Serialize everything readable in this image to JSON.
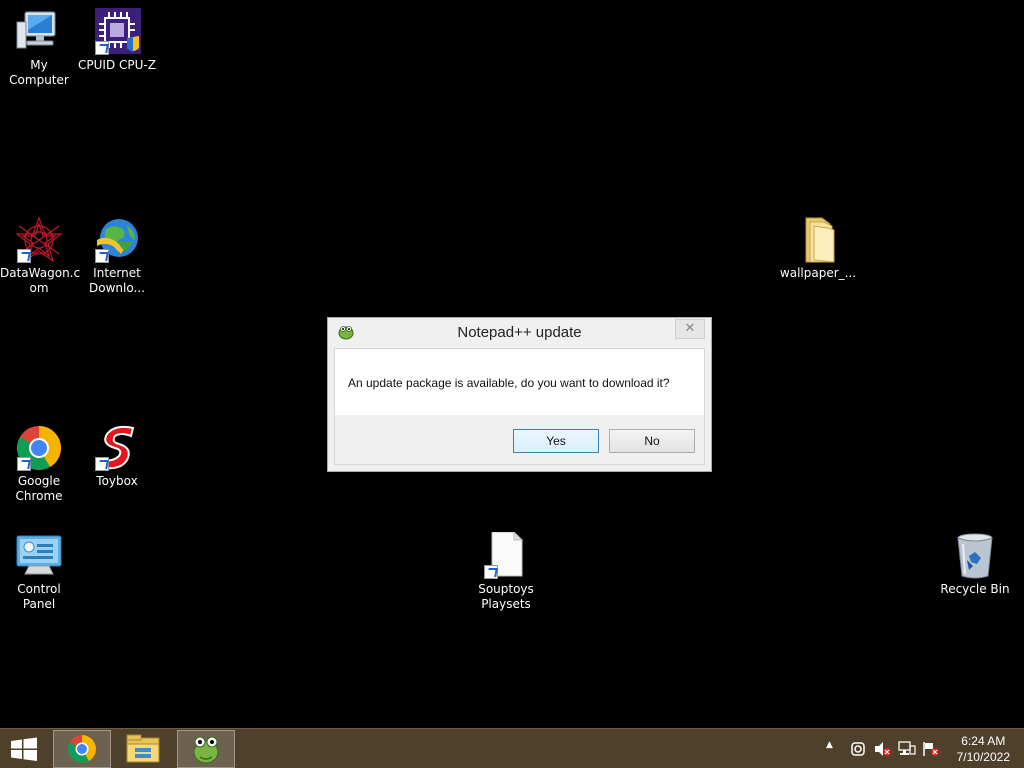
{
  "desktop": {
    "icons": [
      {
        "id": "my-computer",
        "label_lines": [
          "My Computer"
        ],
        "icon": "computer-icon",
        "shortcut": false
      },
      {
        "id": "cpuz",
        "label_lines": [
          "CPUID CPU-Z"
        ],
        "icon": "cpu-chip-icon",
        "shortcut": true
      },
      {
        "id": "datawagon",
        "label_lines": [
          "DataWagon.c",
          "om"
        ],
        "icon": "datawagon-star-icon",
        "shortcut": true
      },
      {
        "id": "idm",
        "label_lines": [
          "Internet",
          "Downlo..."
        ],
        "icon": "globe-download-icon",
        "shortcut": true
      },
      {
        "id": "wallpaper",
        "label_lines": [
          "wallpaper_..."
        ],
        "icon": "folder-icon",
        "shortcut": false
      },
      {
        "id": "chrome",
        "label_lines": [
          "Google",
          "Chrome"
        ],
        "icon": "chrome-icon",
        "shortcut": true
      },
      {
        "id": "toybox",
        "label_lines": [
          "Toybox"
        ],
        "icon": "toybox-s-icon",
        "shortcut": true
      },
      {
        "id": "control-panel",
        "label_lines": [
          "Control Panel"
        ],
        "icon": "control-panel-icon",
        "shortcut": false
      },
      {
        "id": "souptoys",
        "label_lines": [
          "Souptoys",
          "Playsets"
        ],
        "icon": "document-icon",
        "shortcut": true
      },
      {
        "id": "recycle",
        "label_lines": [
          "Recycle Bin"
        ],
        "icon": "recycle-bin-icon",
        "shortcut": false
      }
    ]
  },
  "dialog": {
    "title": "Notepad++ update",
    "message": "An update package is available, do you want to download it?",
    "yes_label": "Yes",
    "no_label": "No",
    "close_glyph": "✕"
  },
  "taskbar": {
    "pinned": [
      "windows-start-icon",
      "chrome-icon",
      "file-explorer-icon",
      "notepadpp-icon"
    ],
    "tray_icons": [
      "show-hidden-icons-chevron",
      "sync-icon",
      "volume-muted-icon",
      "network-icon",
      "action-center-flag-icon"
    ],
    "tray_chevron": "▲",
    "time": "6:24 AM",
    "date": "7/10/2022"
  },
  "colors": {
    "desktop_background": "#000000",
    "taskbar": "#4e402a",
    "dialog_background": "#f0f0f0",
    "default_button_border": "#3c7fb1"
  }
}
